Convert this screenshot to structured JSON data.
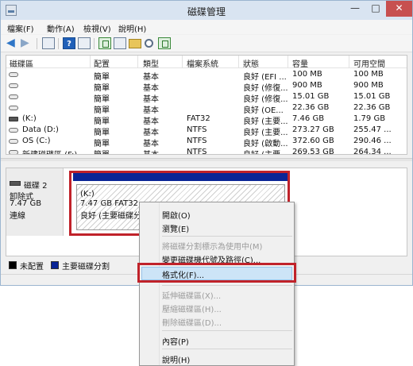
{
  "window": {
    "title": "磁碟管理",
    "controls": {
      "minimize": "—",
      "maximize": "□",
      "close": "✕"
    }
  },
  "menu": [
    "檔案(F)",
    "動作(A)",
    "檢視(V)",
    "說明(H)"
  ],
  "toolbar": {
    "icons": [
      "back-arrow-icon",
      "forward-arrow-icon",
      "properties-grid-icon",
      "help-icon",
      "refresh-icon",
      "new-folder-icon",
      "open-folder-icon",
      "search-icon",
      "settings-icon"
    ],
    "help_label": "?"
  },
  "volumes": {
    "columns": [
      "磁碟區",
      "配置",
      "類型",
      "檔案系統",
      "狀態",
      "容量",
      "可用空間"
    ],
    "rows": [
      {
        "name": "",
        "layout": "簡單",
        "type": "基本",
        "fs": "",
        "status": "良好 (EFI ...",
        "capacity": "100 MB",
        "free": "100 MB",
        "icon": "drive-icon"
      },
      {
        "name": "",
        "layout": "簡單",
        "type": "基本",
        "fs": "",
        "status": "良好 (修復...",
        "capacity": "900 MB",
        "free": "900 MB",
        "icon": "drive-icon"
      },
      {
        "name": "",
        "layout": "簡單",
        "type": "基本",
        "fs": "",
        "status": "良好 (修復...",
        "capacity": "15.01 GB",
        "free": "15.01 GB",
        "icon": "drive-icon"
      },
      {
        "name": "",
        "layout": "簡單",
        "type": "基本",
        "fs": "",
        "status": "良好 (OE...",
        "capacity": "22.36 GB",
        "free": "22.36 GB",
        "icon": "drive-icon"
      },
      {
        "name": "(K:)",
        "layout": "簡單",
        "type": "基本",
        "fs": "FAT32",
        "status": "良好 (主要...",
        "capacity": "7.46 GB",
        "free": "1.79 GB",
        "icon": "usb-drive-icon"
      },
      {
        "name": "Data (D:)",
        "layout": "簡單",
        "type": "基本",
        "fs": "NTFS",
        "status": "良好 (主要...",
        "capacity": "273.27 GB",
        "free": "255.47 ...",
        "icon": "drive-icon"
      },
      {
        "name": "OS (C:)",
        "layout": "簡單",
        "type": "基本",
        "fs": "NTFS",
        "status": "良好 (啟動...",
        "capacity": "372.60 GB",
        "free": "290.46 ...",
        "icon": "drive-icon"
      },
      {
        "name": "新建磁碟區 (F:)",
        "layout": "簡單",
        "type": "基本",
        "fs": "NTFS",
        "status": "良好 (主要...",
        "capacity": "269.53 GB",
        "free": "264.34 ...",
        "icon": "drive-icon"
      }
    ]
  },
  "disk": {
    "name": "磁碟 2",
    "kind": "卸除式",
    "size": "7.47 GB",
    "state": "連線",
    "partition": {
      "label": "(K:)",
      "size_fs": "7.47 GB FAT32",
      "status": "良好 (主要磁碟分"
    }
  },
  "legend": [
    {
      "label": "未配置",
      "color": "#000000"
    },
    {
      "label": "主要磁碟分割",
      "color": "#0a2596"
    }
  ],
  "context_menu": {
    "items": [
      {
        "label": "開啟(O)",
        "enabled": true
      },
      {
        "label": "瀏覽(E)",
        "enabled": true
      },
      {
        "label": "將磁碟分割標示為使用中(M)",
        "enabled": false
      },
      {
        "label": "變更磁碟機代號及路徑(C)...",
        "enabled": true
      },
      {
        "label": "格式化(F)...",
        "enabled": true,
        "selected": true
      },
      {
        "label": "延伸磁碟區(X)...",
        "enabled": false
      },
      {
        "label": "壓縮磁碟區(H)...",
        "enabled": false
      },
      {
        "label": "刪除磁碟區(D)...",
        "enabled": false
      },
      {
        "label": "內容(P)",
        "enabled": true
      },
      {
        "label": "說明(H)",
        "enabled": true
      }
    ]
  },
  "colors": {
    "primary_partition": "#0a2596",
    "highlight": "#c0222a",
    "menu_selection": "#cce4f7"
  }
}
